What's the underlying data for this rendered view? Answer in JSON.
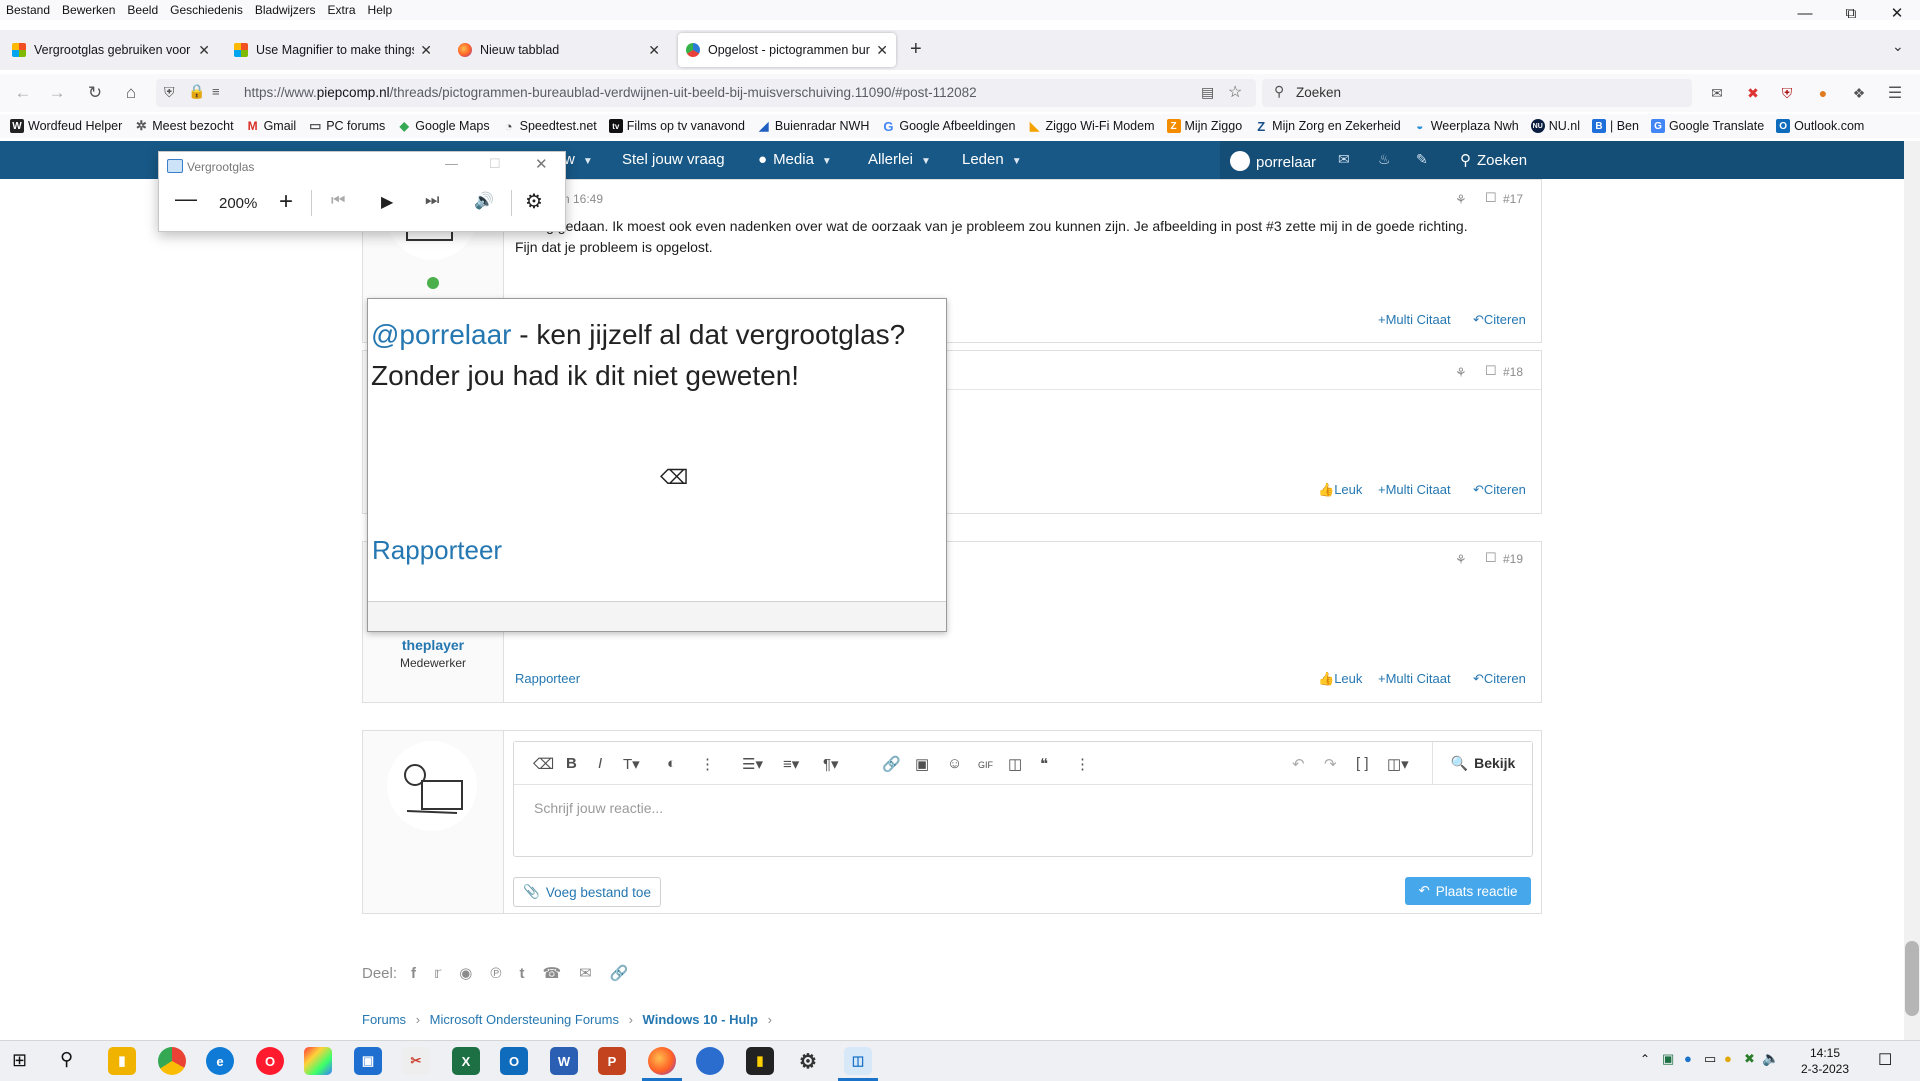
{
  "menubar": {
    "items": [
      "Bestand",
      "Bewerken",
      "Beeld",
      "Geschiedenis",
      "Bladwijzers",
      "Extra",
      "Help"
    ]
  },
  "tabs": [
    {
      "title": "Vergrootglas gebruiken voor een",
      "active": false
    },
    {
      "title": "Use Magnifier to make things o",
      "active": false
    },
    {
      "title": "Nieuw tabblad",
      "active": false
    },
    {
      "title": "Opgelost - pictogrammen bure",
      "active": true
    }
  ],
  "nav": {
    "url_prefix": "https://www.",
    "url_domain": "piepcomp.nl",
    "url_path": "/threads/pictogrammen-bureaublad-verdwijnen-uit-beeld-bij-muisverschuiving.11090/#post-112082",
    "search_placeholder": "Zoeken"
  },
  "bookmarks": [
    {
      "label": "Wordfeud Helper",
      "icon": "W",
      "color": "#222222"
    },
    {
      "label": "Meest bezocht",
      "icon": "✲",
      "color": "#555555"
    },
    {
      "label": "Gmail",
      "icon": "M",
      "color": "#d93025"
    },
    {
      "label": "PC forums",
      "icon": "▭",
      "color": "#777777"
    },
    {
      "label": "Google Maps",
      "icon": "◆",
      "color": "#34a853"
    },
    {
      "label": "Speedtest.net",
      "icon": "◔",
      "color": "#444444"
    },
    {
      "label": "Films op tv vanavond",
      "icon": "tv",
      "color": "#111111"
    },
    {
      "label": "Buienradar NWH",
      "icon": "◢",
      "color": "#1f5fbf"
    },
    {
      "label": "Google Afbeeldingen",
      "icon": "G",
      "color": "#4285f4"
    },
    {
      "label": "Ziggo Wi-Fi Modem",
      "icon": "◣",
      "color": "#f5a100"
    },
    {
      "label": "Mijn Ziggo",
      "icon": "Z",
      "color": "#f48c00"
    },
    {
      "label": "Mijn Zorg en Zekerheid",
      "icon": "Z",
      "color": "#1a4f8a"
    },
    {
      "label": "Weerplaza Nwh",
      "icon": "◒",
      "color": "#2a8fd6"
    },
    {
      "label": "NU.nl",
      "icon": "NU",
      "color": "#0b1e3f"
    },
    {
      "label": "| Ben",
      "icon": "B",
      "color": "#1e6fd9"
    },
    {
      "label": "Google Translate",
      "icon": "G",
      "color": "#4285f4"
    },
    {
      "label": "Outlook.com",
      "icon": "O",
      "color": "#0f6cbd"
    }
  ],
  "site_nav": {
    "partial_item": "w",
    "items": [
      "Stel jouw vraag",
      "Media",
      "Allerlei",
      "Leden"
    ],
    "user": "porrelaar",
    "search": "Zoeken"
  },
  "posts": [
    {
      "number": "#17",
      "time": "om 16:49",
      "text_line1": "Graag gedaan. Ik moest ook even nadenken over wat de oorzaak van je probleem zou kunnen zijn. Je afbeelding in post #3 zette mij in de goede richting.",
      "text_line2": "Fijn dat je probleem is opgelost.",
      "multi": "Multi Citaat",
      "quote": "Citeren"
    },
    {
      "number": "#18",
      "like": "Leuk",
      "multi": "Multi Citaat",
      "quote": "Citeren"
    },
    {
      "number": "#19",
      "author": "theplayer",
      "role": "Medewerker",
      "report": "Rapporteer",
      "like": "Leuk",
      "multi": "Multi Citaat",
      "quote": "Citeren"
    }
  ],
  "magnifier": {
    "title": "Vergrootglas",
    "zoom": "200%",
    "lens_mention": "@porrelaar",
    "lens_line1_rest": " - ken jijzelf al dat vergrootglas?",
    "lens_line2": "Zonder jou had ik dit niet geweten!",
    "lens_report": "Rapporteer"
  },
  "editor": {
    "placeholder": "Schrijf jouw reactie...",
    "preview": "Bekijk",
    "attach": "Voeg bestand toe",
    "submit": "Plaats reactie"
  },
  "share": {
    "label": "Deel:"
  },
  "breadcrumb": [
    "Forums",
    "Microsoft Ondersteuning Forums",
    "Windows 10 - Hulp"
  ],
  "clock": {
    "time": "14:15",
    "date": "2-3-2023"
  }
}
